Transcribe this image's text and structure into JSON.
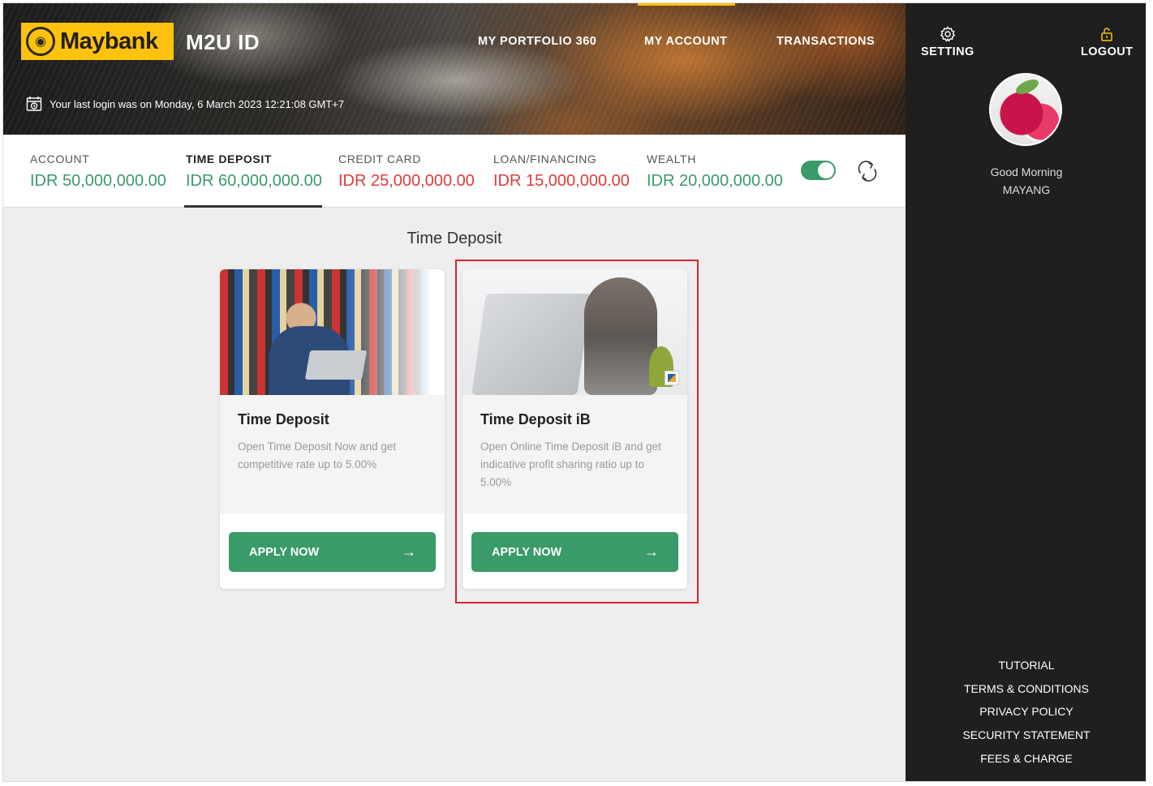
{
  "header": {
    "brand": "Maybank",
    "app_title": "M2U ID",
    "nav": [
      "MY PORTFOLIO 360",
      "MY ACCOUNT",
      "TRANSACTIONS"
    ],
    "last_login": "Your last login was on Monday, 6 March 2023 12:21:08 GMT+7"
  },
  "summary": [
    {
      "label": "ACCOUNT",
      "value": "IDR 50,000,000.00",
      "color": "#3a9a6a"
    },
    {
      "label": "TIME DEPOSIT",
      "value": "IDR 60,000,000.00",
      "color": "#3a9a6a",
      "active": true
    },
    {
      "label": "CREDIT CARD",
      "value": "IDR 25,000,000.00",
      "color": "#e03b3b"
    },
    {
      "label": "LOAN/FINANCING",
      "value": "IDR 15,000,000.00",
      "color": "#e03b3b"
    },
    {
      "label": "WEALTH",
      "value": "IDR 20,000,000.00",
      "color": "#3a9a6a"
    }
  ],
  "section_title": "Time Deposit",
  "cards": [
    {
      "title": "Time Deposit",
      "description": "Open Time Deposit Now and get competitive rate up to 5.00%",
      "button": "APPLY NOW"
    },
    {
      "title": "Time Deposit iB",
      "description": "Open Online Time Deposit iB and get indicative profit sharing ratio up to 5.00%",
      "button": "APPLY NOW"
    }
  ],
  "sidebar": {
    "setting": "SETTING",
    "logout": "LOGOUT",
    "greeting": "Good Morning",
    "user": "MAYANG",
    "links": [
      "TUTORIAL",
      "TERMS & CONDITIONS",
      "PRIVACY POLICY",
      "SECURITY STATEMENT",
      "FEES & CHARGE"
    ]
  },
  "colors": {
    "accent": "#3a9a6a",
    "brand_yellow": "#ffc20e",
    "negative": "#e03b3b",
    "highlight": "#d9262e"
  }
}
